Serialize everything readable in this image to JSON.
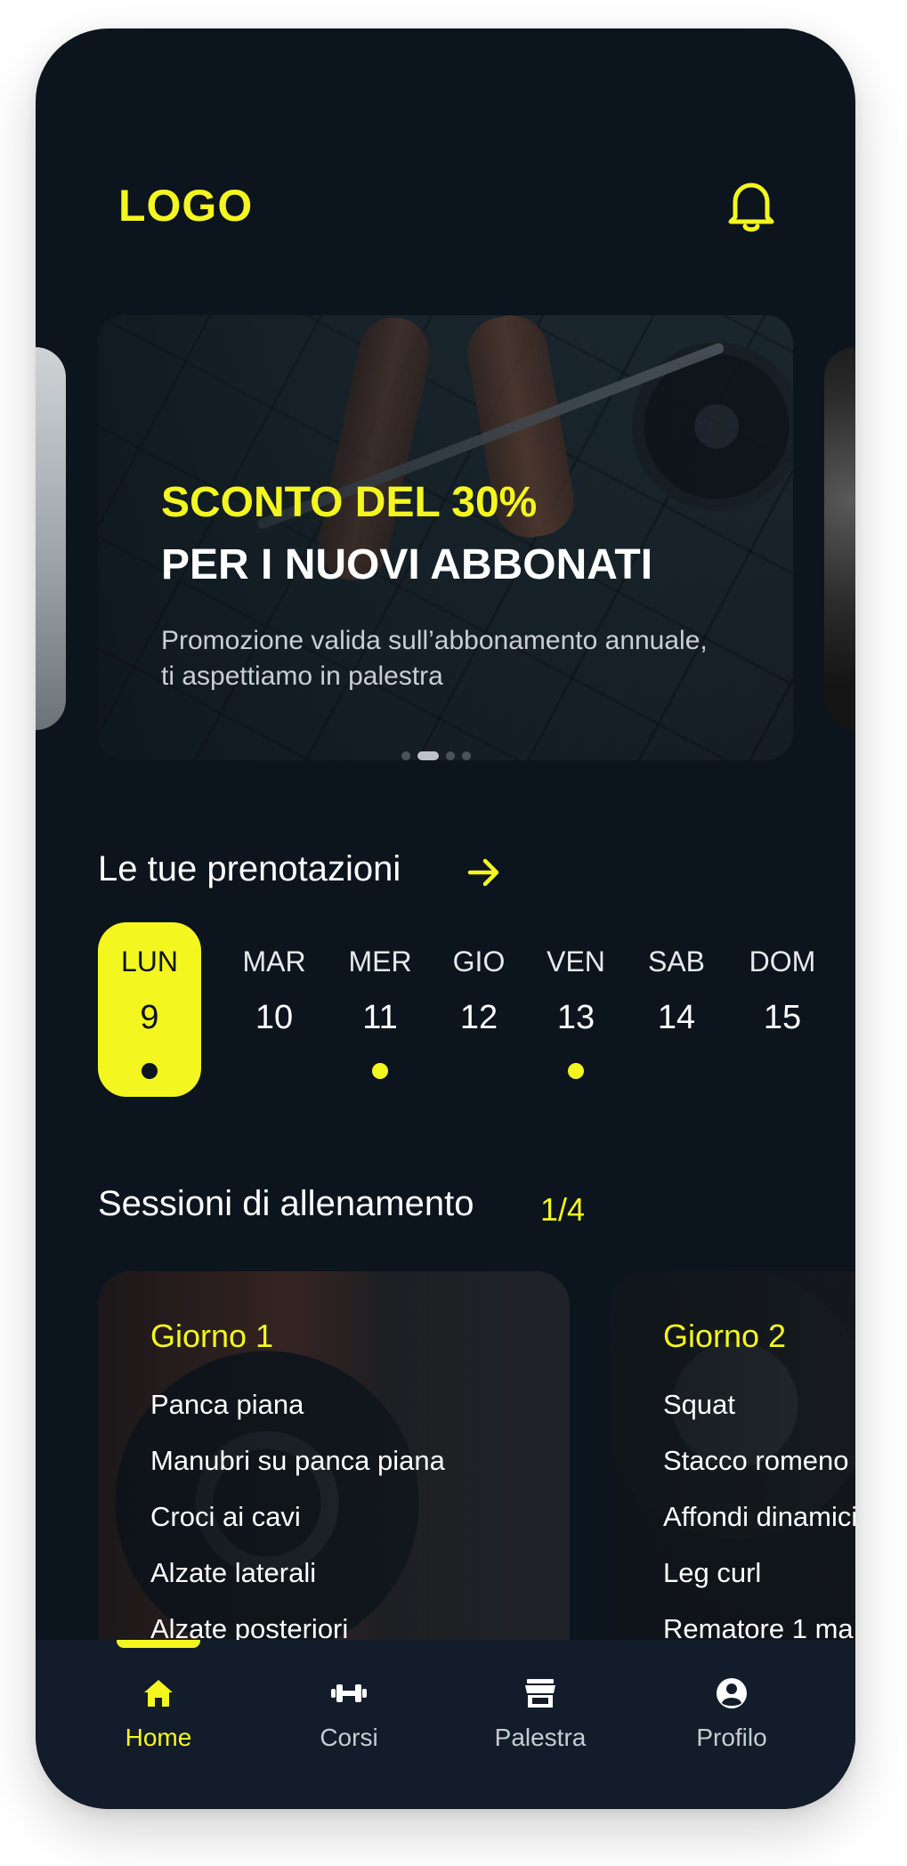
{
  "header": {
    "logo": "LOGO",
    "bell_icon": "bell-icon"
  },
  "promo": {
    "title_highlight": "SCONTO DEL 30%",
    "title": "PER I NUOVI ABBONATI",
    "description": "Promozione valida sull’abbonamento annuale, ti aspettiamo in palestra",
    "pages": 4,
    "active_page": 2
  },
  "bookings": {
    "title": "Le tue prenotazioni",
    "days": [
      {
        "name": "LUN",
        "date": "9",
        "active": true,
        "booked": true
      },
      {
        "name": "MAR",
        "date": "10",
        "active": false,
        "booked": false
      },
      {
        "name": "MER",
        "date": "11",
        "active": false,
        "booked": true
      },
      {
        "name": "GIO",
        "date": "12",
        "active": false,
        "booked": false
      },
      {
        "name": "VEN",
        "date": "13",
        "active": false,
        "booked": true
      },
      {
        "name": "SAB",
        "date": "14",
        "active": false,
        "booked": false
      },
      {
        "name": "DOM",
        "date": "15",
        "active": false,
        "booked": false
      }
    ]
  },
  "sessions": {
    "title": "Sessioni di allenamento",
    "counter": "1/4",
    "cards": [
      {
        "title": "Giorno 1",
        "exercises": [
          "Panca piana",
          "Manubri su panca piana",
          "Croci ai cavi",
          "Alzate laterali",
          "Alzate posteriori"
        ]
      },
      {
        "title": "Giorno 2",
        "exercises": [
          "Squat",
          "Stacco romeno",
          "Affondi dinamici",
          "Leg curl",
          "Rematore 1 ma"
        ]
      }
    ]
  },
  "nav": {
    "items": [
      {
        "label": "Home",
        "icon": "home-icon",
        "active": true
      },
      {
        "label": "Corsi",
        "icon": "dumbbell-icon",
        "active": false
      },
      {
        "label": "Palestra",
        "icon": "store-icon",
        "active": false
      },
      {
        "label": "Profilo",
        "icon": "user-circle-icon",
        "active": false
      }
    ]
  },
  "colors": {
    "background": "#0c141d",
    "accent": "#f4f71f",
    "nav": "#121c2a",
    "text": "#ffffff"
  }
}
